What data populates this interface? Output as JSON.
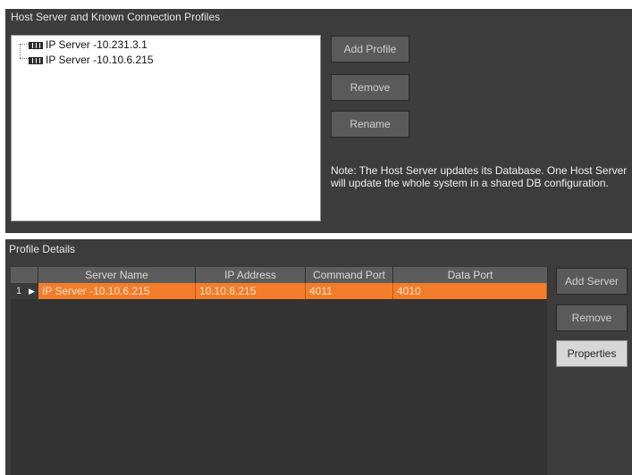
{
  "top_panel": {
    "title": "Host Server and Known Connection Profiles",
    "tree": [
      {
        "label": "IP Server -10.231.3.1"
      },
      {
        "label": "IP Server -10.10.6.215"
      }
    ],
    "buttons": {
      "add_profile": "Add Profile",
      "remove": "Remove",
      "rename": "Rename"
    },
    "note": "Note: The Host Server updates its Database.  One Host Server will update the whole system in a shared DB configuration."
  },
  "bottom_panel": {
    "title": "Profile Details",
    "columns": [
      "Server Name",
      "IP Address",
      "Command Port",
      "Data Port"
    ],
    "rows": [
      {
        "num": "1",
        "server_name": "IP Server -10.10.6.215",
        "ip_address": "10.10.6.215",
        "command_port": "4011",
        "data_port": "4010"
      }
    ],
    "buttons": {
      "add_server": "Add Server",
      "remove": "Remove",
      "properties": "Properties"
    }
  },
  "colors": {
    "panel_bg": "#3c3c3c",
    "selected_row": "#f47d2a",
    "button_bg": "#5a5a5a"
  },
  "icons": {
    "tree_node": "server-icon",
    "row_indicator": "triangle-right-icon"
  }
}
